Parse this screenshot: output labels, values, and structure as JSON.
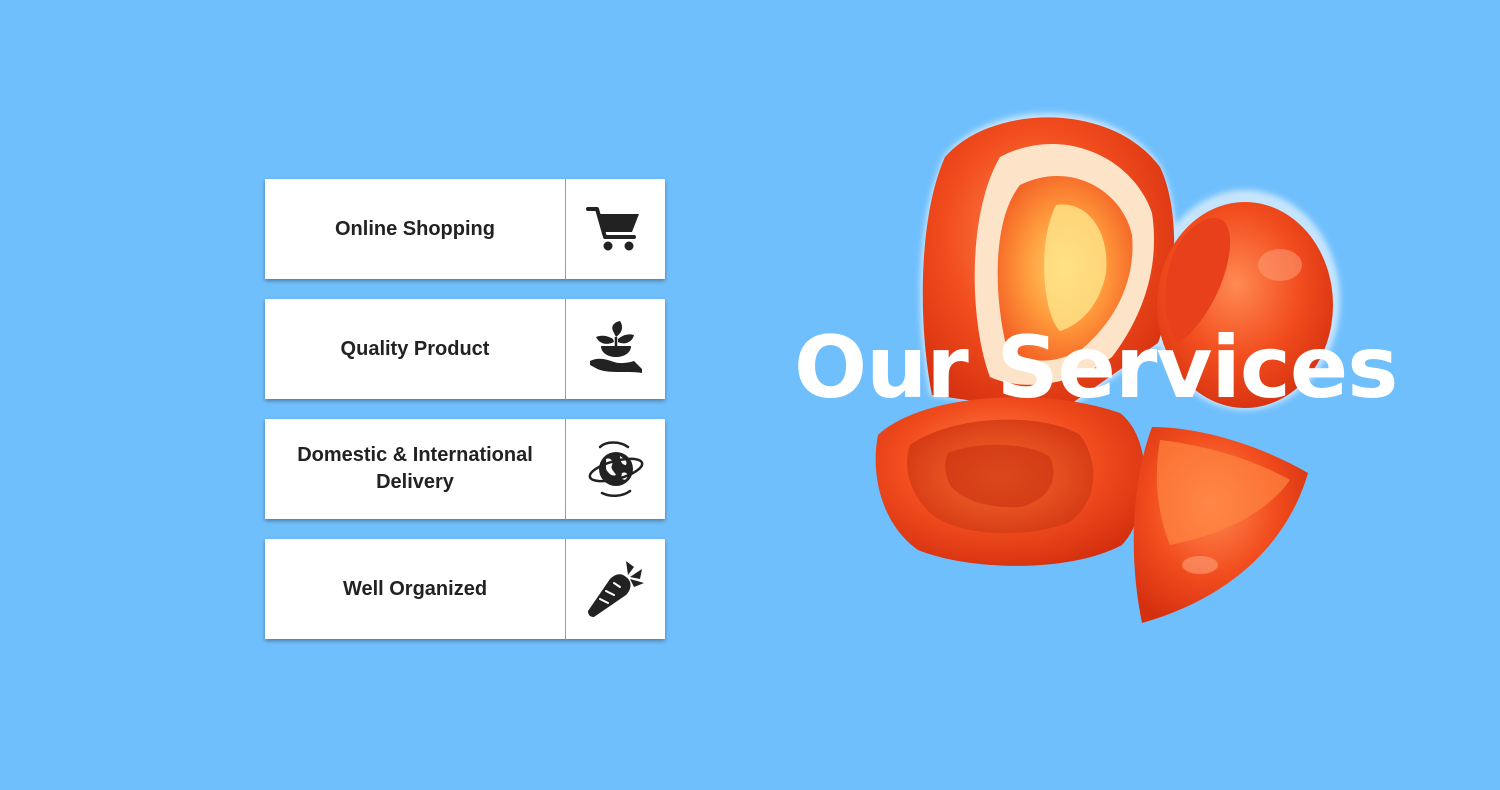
{
  "section": {
    "title": "Our Services"
  },
  "services": [
    {
      "label": "Online Shopping",
      "icon": "shopping-cart-icon"
    },
    {
      "label": "Quality Product",
      "icon": "hand-plant-icon"
    },
    {
      "label": "Domestic & International Delivery",
      "icon": "globe-orbit-icon"
    },
    {
      "label": "Well Organized",
      "icon": "carrot-icon"
    }
  ],
  "colors": {
    "background": "#70bffd",
    "card": "#ffffff",
    "text": "#222222",
    "title": "#ffffff",
    "tomato": "#f0421c"
  }
}
